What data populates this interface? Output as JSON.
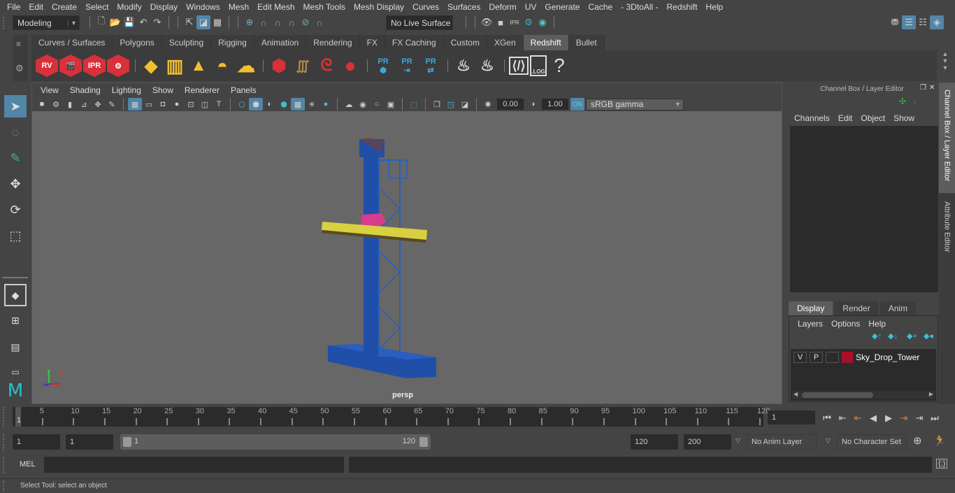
{
  "menubar": {
    "items": [
      "File",
      "Edit",
      "Create",
      "Select",
      "Modify",
      "Display",
      "Windows",
      "Mesh",
      "Edit Mesh",
      "Mesh Tools",
      "Mesh Display",
      "Curves",
      "Surfaces",
      "Deform",
      "UV",
      "Generate",
      "Cache",
      "- 3DtoAll -",
      "Redshift",
      "Help"
    ]
  },
  "statusline": {
    "mode": "Modeling",
    "live_surface": "No Live Surface"
  },
  "shelf": {
    "tabs": [
      "Curves / Surfaces",
      "Polygons",
      "Sculpting",
      "Rigging",
      "Animation",
      "Rendering",
      "FX",
      "FX Caching",
      "Custom",
      "XGen",
      "Redshift",
      "Bullet"
    ],
    "active_tab": "Redshift",
    "icons": [
      {
        "name": "redshift-render-view-icon",
        "label": "RV"
      },
      {
        "name": "redshift-batch-render-icon",
        "label": ""
      },
      {
        "name": "redshift-ipr-icon",
        "label": "IPR"
      },
      {
        "name": "redshift-render-settings-icon",
        "label": ""
      },
      {
        "name": "redshift-area-light-icon",
        "label": ""
      },
      {
        "name": "redshift-portal-light-icon",
        "label": ""
      },
      {
        "name": "redshift-spot-light-icon",
        "label": ""
      },
      {
        "name": "redshift-dome-light-icon",
        "label": ""
      },
      {
        "name": "redshift-sun-sky-icon",
        "label": ""
      },
      {
        "name": "redshift-proxy-icon",
        "label": ""
      },
      {
        "name": "redshift-hair-icon",
        "label": ""
      },
      {
        "name": "redshift-volume-icon",
        "label": ""
      },
      {
        "name": "redshift-sphere-icon",
        "label": ""
      },
      {
        "name": "redshift-proxy-create-icon",
        "label": "PR"
      },
      {
        "name": "redshift-proxy-export-icon",
        "label": "PR"
      },
      {
        "name": "redshift-proxy-swap-icon",
        "label": "PR"
      },
      {
        "name": "redshift-bake-icon",
        "label": ""
      },
      {
        "name": "redshift-bake-set-icon",
        "label": ""
      },
      {
        "name": "redshift-script-editor-icon",
        "label": ""
      },
      {
        "name": "redshift-log-icon",
        "label": ".LOG"
      },
      {
        "name": "redshift-help-icon",
        "label": "?"
      }
    ]
  },
  "viewport": {
    "menu": [
      "View",
      "Shading",
      "Lighting",
      "Show",
      "Renderer",
      "Panels"
    ],
    "exposure": "0.00",
    "gamma": "1.00",
    "color_space": "sRGB gamma",
    "camera_label": "persp",
    "axis_labels": {
      "x": "x",
      "y": "y",
      "z": "z"
    }
  },
  "channel_box": {
    "title": "Channel Box / Layer Editor",
    "menu": [
      "Channels",
      "Edit",
      "Object",
      "Show"
    ]
  },
  "layer_editor": {
    "tabs": [
      "Display",
      "Render",
      "Anim"
    ],
    "active_tab": "Display",
    "menu": [
      "Layers",
      "Options",
      "Help"
    ],
    "layers": [
      {
        "visible": "V",
        "playback": "P",
        "name": "Sky_Drop_Tower",
        "color": "#a8102a"
      }
    ]
  },
  "side_tabs": [
    "Channel Box / Layer Editor",
    "Attribute Editor"
  ],
  "timeline": {
    "ticks": [
      5,
      10,
      15,
      20,
      25,
      30,
      35,
      40,
      45,
      50,
      55,
      60,
      65,
      70,
      75,
      80,
      85,
      90,
      95,
      100,
      105,
      110,
      115,
      120
    ],
    "min": 1,
    "max": 120,
    "current_frame_marker": "1",
    "current_frame": "1"
  },
  "range": {
    "start": "1",
    "playback_start": "1",
    "slider_start": "1",
    "slider_end": "120",
    "playback_end": "120",
    "end": "200",
    "anim_layer": "No Anim Layer",
    "character_set": "No Character Set"
  },
  "command_line": {
    "label": "MEL",
    "value": "",
    "result": ""
  },
  "help_line": {
    "text": "Select Tool: select an object"
  },
  "colors": {
    "accent": "#5285a6",
    "redshift_red": "#d9303a",
    "light_yellow": "#f0c030",
    "tower_blue": "#1f4fa8",
    "layer_color": "#a8102a"
  }
}
